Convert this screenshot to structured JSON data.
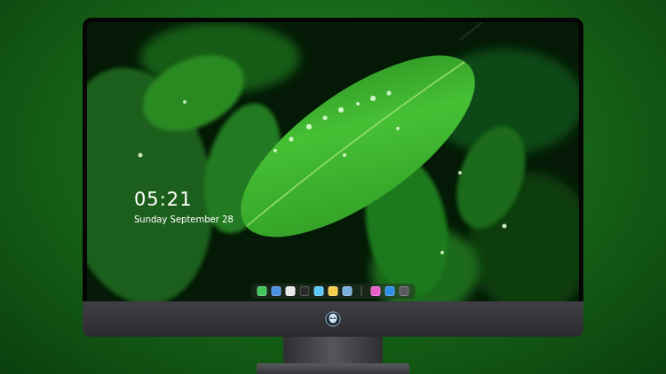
{
  "lock_screen": {
    "time": "05:21",
    "date": "Sunday September 28"
  },
  "dock": {
    "groups": [
      {
        "items": [
          {
            "app": "messages",
            "color": "#3ec65a"
          },
          {
            "app": "finder",
            "color": "#4a8fe0"
          },
          {
            "app": "clock",
            "color": "#e6e6e6"
          },
          {
            "app": "clapper",
            "color": "#2a2a2a"
          },
          {
            "app": "video",
            "color": "#5ac8fa"
          },
          {
            "app": "notes",
            "color": "#f3d04a"
          },
          {
            "app": "preview",
            "color": "#7ab0dd"
          }
        ]
      },
      {
        "items": [
          {
            "app": "music",
            "color": "#e95fc8"
          },
          {
            "app": "store",
            "color": "#2f8ee8"
          },
          {
            "app": "camera",
            "color": "#5a5a5e"
          }
        ]
      }
    ]
  }
}
